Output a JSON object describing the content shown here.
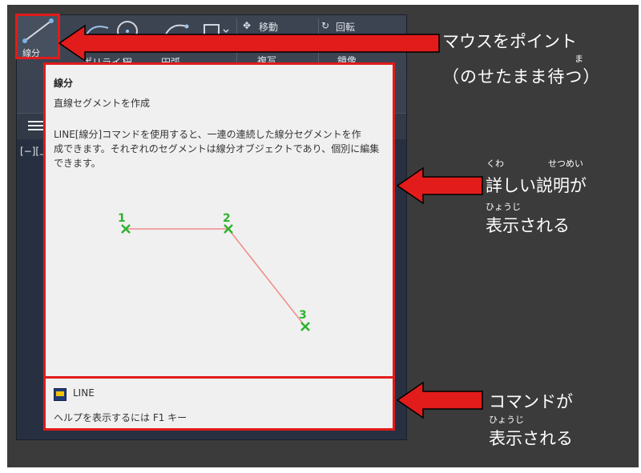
{
  "ribbon": {
    "row1": [
      "移動",
      "回転"
    ],
    "row2": [
      "線分",
      "ポリライン",
      "円",
      "円弧",
      "複写",
      "鏡像"
    ]
  },
  "viewport": {
    "label": "[−][上]"
  },
  "line_button": {
    "label": "線分"
  },
  "tooltip": {
    "title": "線分",
    "subtitle": "直線セグメントを作成",
    "description": "LINE[線分]コマンドを使用すると、一連の連続した線分セグメントを作\n成できます。それぞれのセグメントは線分オブジェクトであり、個別に編集\nできます。",
    "points": [
      "1",
      "2",
      "3"
    ],
    "command": "LINE",
    "help": "ヘルプを表示するには F1 キー"
  },
  "callouts": {
    "hover": {
      "ruby": "ま",
      "line1": "マウスをポイント",
      "line2": "（のせたまま待つ）"
    },
    "description": {
      "ruby1": "くわ",
      "ruby2": "せつめい",
      "ruby3": "ひょうじ",
      "line1": "詳しい説明が",
      "line2": "表示される"
    },
    "command": {
      "ruby": "ひょうじ",
      "line1": "コマンドが",
      "line2": "表示される"
    }
  },
  "colors": {
    "accent_red": "#e21b1b",
    "point_green": "#2db32d",
    "line_pink": "#f08a8a"
  }
}
